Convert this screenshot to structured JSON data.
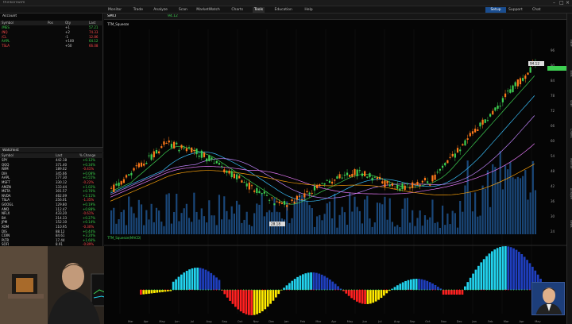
{
  "window": {
    "title": "thinkorswim"
  },
  "topbar": {
    "items": [
      "Monitor",
      "Trade",
      "Analyze",
      "Scan",
      "MarketWatch",
      "Charts",
      "Tools",
      "Education",
      "Help"
    ],
    "right_buttons": [
      "Setup",
      "Support",
      "Chat"
    ]
  },
  "left": {
    "account_label": "Account",
    "watchlist1_header": [
      "Symbol",
      "Pos",
      "Qty",
      "Last"
    ],
    "watchlist1": [
      {
        "sym": "/MES",
        "qty": "+1",
        "last": "57.21",
        "dir": "up"
      },
      {
        "sym": "/NQ",
        "qty": "+2",
        "last": "74.33",
        "dir": "dn"
      },
      {
        "sym": "/CL",
        "qty": "-1",
        "last": "12.86",
        "dir": "dn"
      },
      {
        "sym": "AAPL",
        "qty": "+100",
        "last": "64.12",
        "dir": "up"
      },
      {
        "sym": "TSLA",
        "qty": "+50",
        "last": "66.08",
        "dir": "dn"
      }
    ],
    "watchlist2_label": "Watchlist",
    "watchlist2_header": [
      "Symbol",
      "Last",
      "% Change"
    ],
    "watchlist2": [
      {
        "sym": "SPY",
        "last": "442.18",
        "chg": "+0.12%",
        "dir": "up"
      },
      {
        "sym": "QQQ",
        "last": "371.40",
        "chg": "+0.34%",
        "dir": "up"
      },
      {
        "sym": "IWM",
        "last": "189.02",
        "chg": "-0.41%",
        "dir": "dn"
      },
      {
        "sym": "DIA",
        "last": "345.66",
        "chg": "+0.08%",
        "dir": "up"
      },
      {
        "sym": "AAPL",
        "last": "177.30",
        "chg": "+0.55%",
        "dir": "up"
      },
      {
        "sym": "MSFT",
        "last": "330.12",
        "chg": "-0.22%",
        "dir": "dn"
      },
      {
        "sym": "AMZN",
        "last": "133.44",
        "chg": "+1.02%",
        "dir": "up"
      },
      {
        "sym": "META",
        "last": "301.57",
        "chg": "+0.76%",
        "dir": "up"
      },
      {
        "sym": "NVDA",
        "last": "462.09",
        "chg": "+2.11%",
        "dir": "up"
      },
      {
        "sym": "TSLA",
        "last": "256.01",
        "chg": "-1.35%",
        "dir": "dn"
      },
      {
        "sym": "GOOGL",
        "last": "129.80",
        "chg": "+0.19%",
        "dir": "up"
      },
      {
        "sym": "AMD",
        "last": "112.47",
        "chg": "+0.88%",
        "dir": "up"
      },
      {
        "sym": "NFLX",
        "last": "433.20",
        "chg": "-0.61%",
        "dir": "dn"
      },
      {
        "sym": "BA",
        "last": "214.33",
        "chg": "+0.27%",
        "dir": "up"
      },
      {
        "sym": "JPM",
        "last": "152.10",
        "chg": "+0.14%",
        "dir": "up"
      },
      {
        "sym": "XOM",
        "last": "110.95",
        "chg": "-0.30%",
        "dir": "dn"
      },
      {
        "sym": "DIS",
        "last": "88.12",
        "chg": "+0.44%",
        "dir": "up"
      },
      {
        "sym": "COIN",
        "last": "84.61",
        "chg": "+3.20%",
        "dir": "up"
      },
      {
        "sym": "PLTR",
        "last": "17.44",
        "chg": "+1.66%",
        "dir": "up"
      },
      {
        "sym": "SOFI",
        "last": "8.91",
        "chg": "-0.89%",
        "dir": "dn"
      },
      {
        "sym": "UBER",
        "last": "47.12",
        "chg": "+0.51%",
        "dir": "up"
      },
      {
        "sym": "BABA",
        "last": "93.20",
        "chg": "-0.74%",
        "dir": "dn"
      },
      {
        "sym": "SHOP",
        "last": "66.30",
        "chg": "+1.20%",
        "dir": "up"
      },
      {
        "sym": "ROKU",
        "last": "71.05",
        "chg": "+0.39%",
        "dir": "up"
      }
    ]
  },
  "chart": {
    "symbol": "SMCI",
    "price_label": "94.12",
    "study_label": "TTM_Squeeze",
    "lower_label": "TTM_Squeeze(MACD)",
    "price_axis": [
      "96",
      "90",
      "84",
      "78",
      "72",
      "66",
      "60",
      "54",
      "48",
      "42",
      "36",
      "30",
      "24"
    ],
    "low_callout": "28.18",
    "high_callout": "94.12",
    "date_ticks": [
      "Mar",
      "Apr",
      "May",
      "Jun",
      "Jul",
      "Aug",
      "Sep",
      "Oct",
      "Nov",
      "Dec",
      "Jan",
      "Feb",
      "Mar",
      "Apr",
      "May",
      "Jun",
      "Jul",
      "Aug",
      "Sep",
      "Oct",
      "Nov",
      "Dec",
      "Jan",
      "Feb",
      "Mar",
      "Apr",
      "May"
    ],
    "colors": {
      "up": "#3ecf52",
      "down": "#ff7a1a",
      "volume": "#1d4f86",
      "cyan": "#22d3ee",
      "blue": "#1f3fbf",
      "red": "#ff2020",
      "yellow": "#ffea00"
    }
  },
  "right_tabs": [
    "Trade",
    "Tools",
    "Scan",
    "Charts",
    "Monitor",
    "Analyze",
    "News"
  ]
}
